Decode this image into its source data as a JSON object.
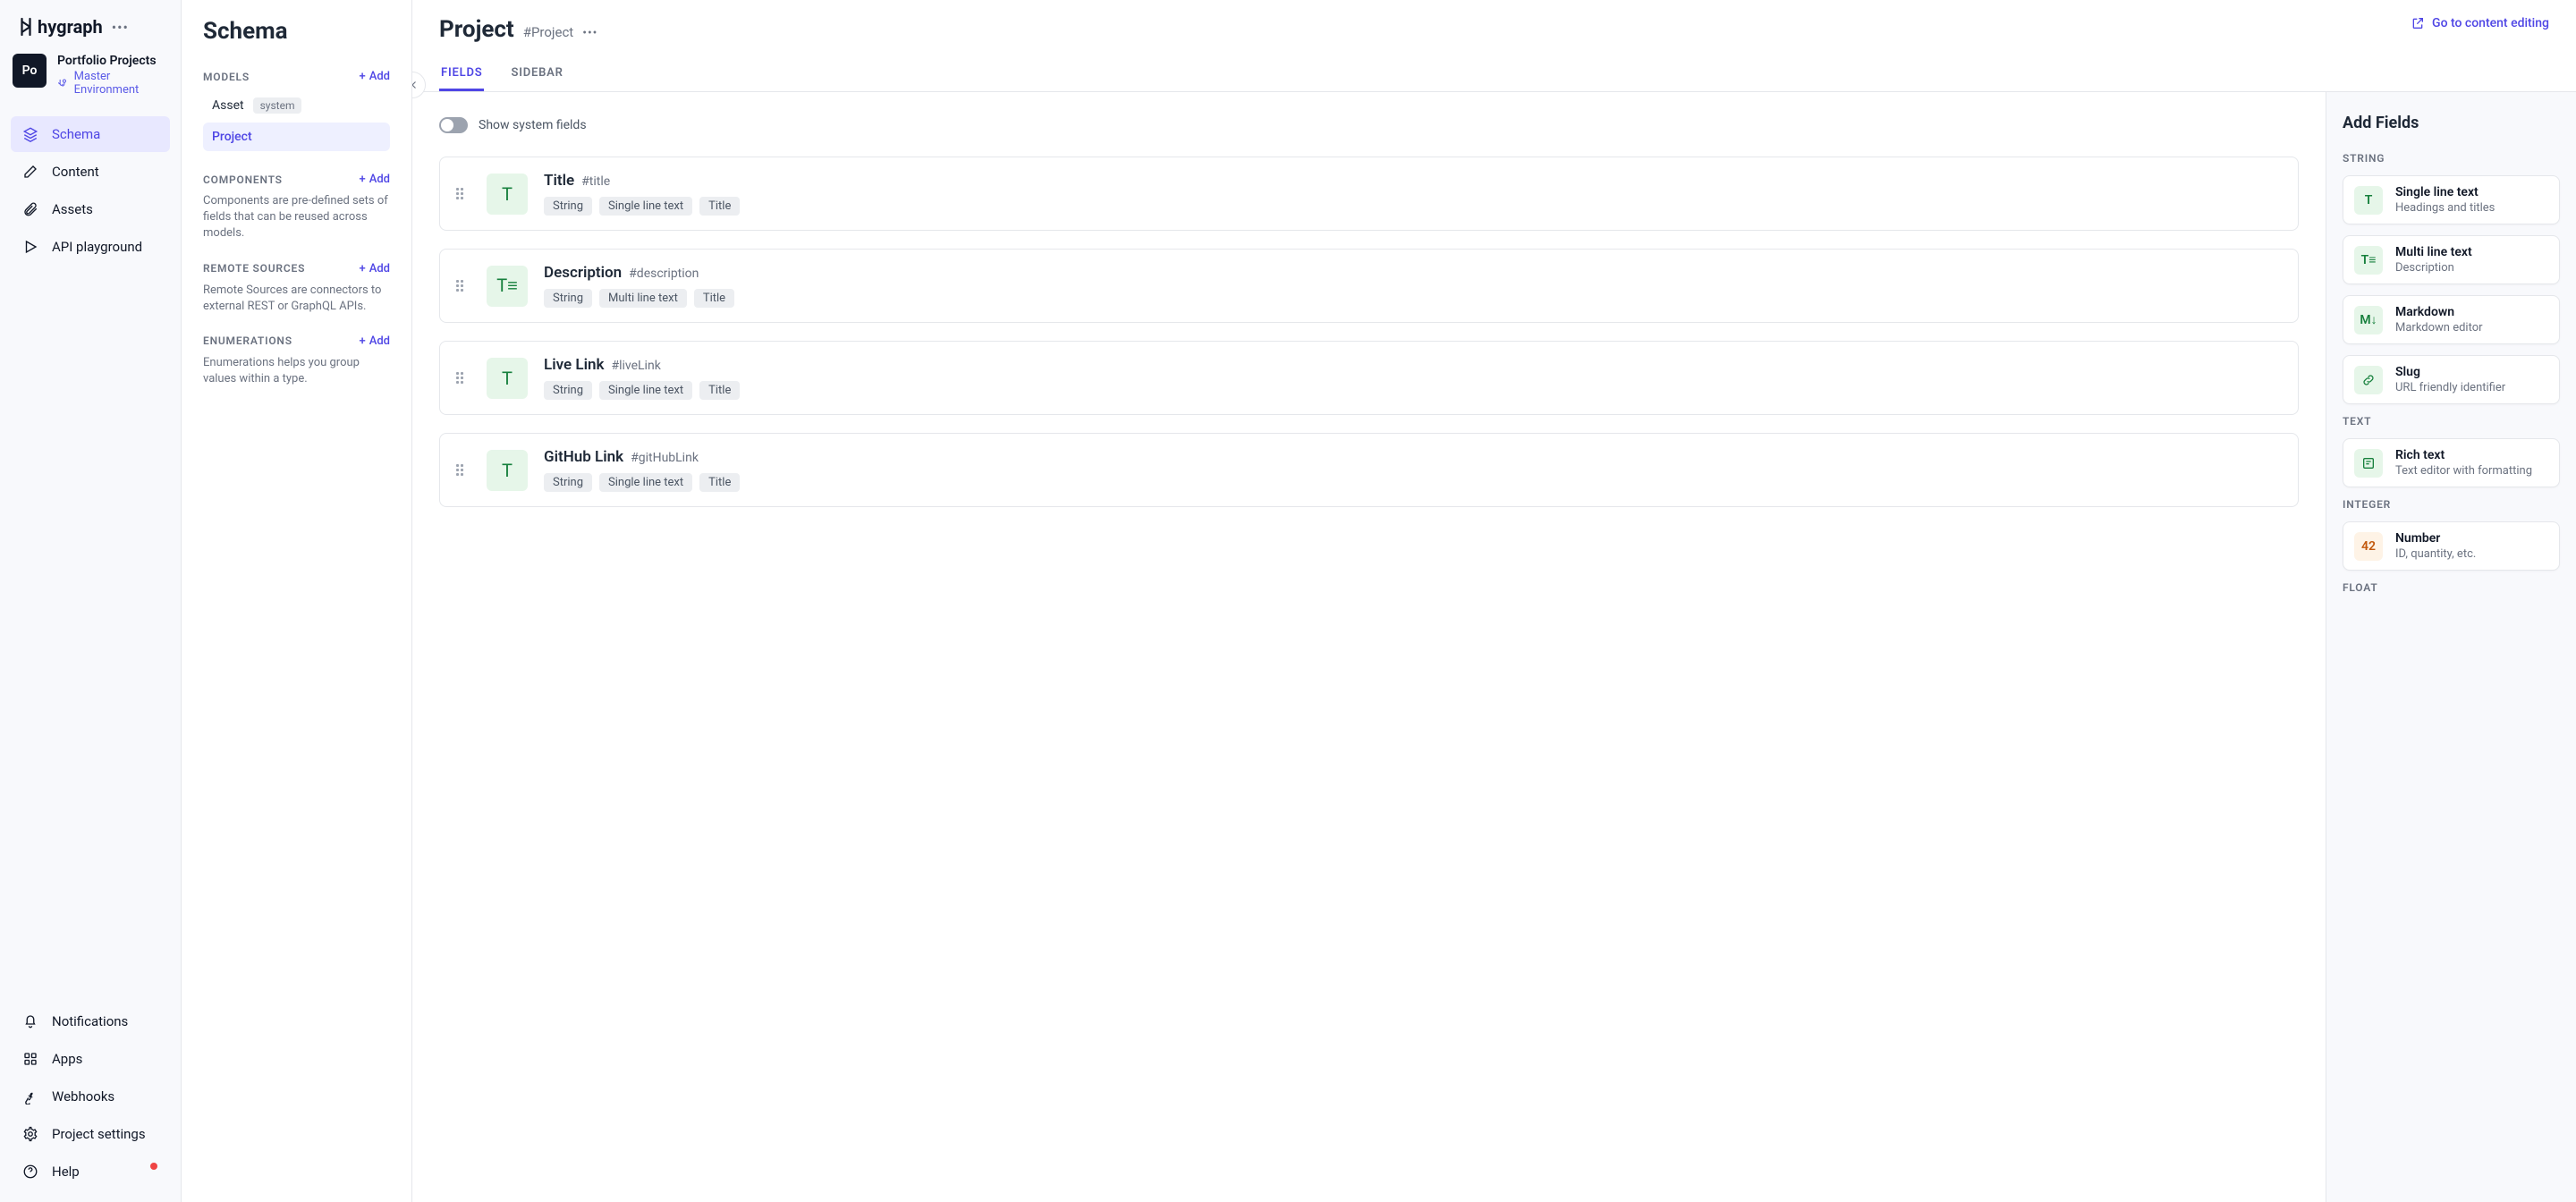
{
  "brand": "hygraph",
  "project": {
    "avatar": "Po",
    "name": "Portfolio Projects",
    "environment": "Master Environment"
  },
  "nav": {
    "schema": "Schema",
    "content": "Content",
    "assets": "Assets",
    "playground": "API playground",
    "notifications": "Notifications",
    "apps": "Apps",
    "webhooks": "Webhooks",
    "settings": "Project settings",
    "help": "Help"
  },
  "schema_panel": {
    "title": "Schema",
    "add": "Add",
    "models_header": "MODELS",
    "models": [
      {
        "name": "Asset",
        "system": true,
        "systemLabel": "system"
      },
      {
        "name": "Project",
        "active": true
      }
    ],
    "components_header": "COMPONENTS",
    "components_help": "Components are pre-defined sets of fields that can be reused across models.",
    "remote_header": "REMOTE SOURCES",
    "remote_help": "Remote Sources are connectors to external REST or GraphQL APIs.",
    "enums_header": "ENUMERATIONS",
    "enums_help": "Enumerations helps you group values within a type."
  },
  "main": {
    "title": "Project",
    "api_id": "#Project",
    "goto": "Go to content editing",
    "tabs": {
      "fields": "FIELDS",
      "sidebar": "SIDEBAR"
    },
    "show_system": "Show system fields",
    "fields": [
      {
        "name": "Title",
        "api": "#title",
        "iconText": "T",
        "tags": [
          "String",
          "Single line text",
          "Title"
        ]
      },
      {
        "name": "Description",
        "api": "#description",
        "iconText": "T≡",
        "tags": [
          "String",
          "Multi line text",
          "Title"
        ]
      },
      {
        "name": "Live Link",
        "api": "#liveLink",
        "iconText": "T",
        "tags": [
          "String",
          "Single line text",
          "Title"
        ]
      },
      {
        "name": "GitHub Link",
        "api": "#gitHubLink",
        "iconText": "T",
        "tags": [
          "String",
          "Single line text",
          "Title"
        ]
      }
    ]
  },
  "right": {
    "title": "Add Fields",
    "sections": {
      "string": "STRING",
      "text": "TEXT",
      "integer": "INTEGER",
      "float": "FLOAT"
    },
    "types": {
      "slt": {
        "name": "Single line text",
        "desc": "Headings and titles",
        "icon": "T"
      },
      "mlt": {
        "name": "Multi line text",
        "desc": "Description",
        "icon": "T≡"
      },
      "md": {
        "name": "Markdown",
        "desc": "Markdown editor",
        "icon": "M↓"
      },
      "slug": {
        "name": "Slug",
        "desc": "URL friendly identifier",
        "icon": "🔗"
      },
      "rt": {
        "name": "Rich text",
        "desc": "Text editor with formatting",
        "icon": "✎"
      },
      "num": {
        "name": "Number",
        "desc": "ID, quantity, etc.",
        "icon": "42"
      }
    }
  }
}
